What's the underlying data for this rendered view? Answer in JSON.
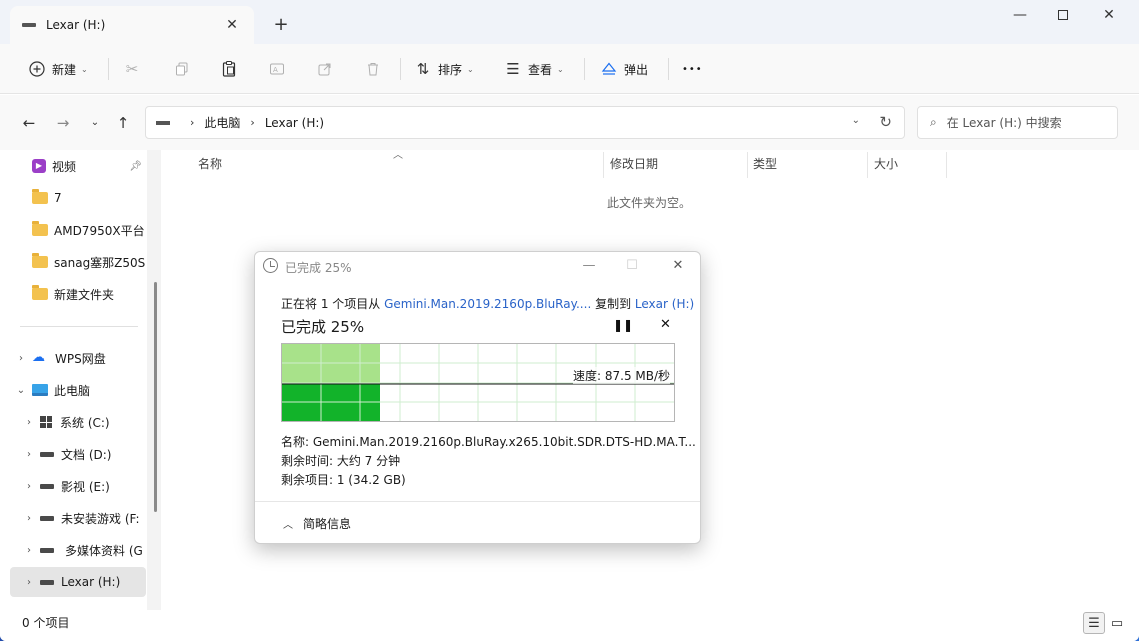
{
  "tab": {
    "title": "Lexar (H:)"
  },
  "toolbar": {
    "new_label": "新建",
    "sort_label": "排序",
    "view_label": "查看",
    "eject_label": "弹出",
    "more_label": "•••"
  },
  "address": {
    "crumbs": [
      "此电脑",
      "Lexar (H:)"
    ]
  },
  "search": {
    "placeholder": "在 Lexar (H:) 中搜索"
  },
  "sidebar": {
    "items": [
      {
        "label": "视频",
        "icon": "video-icon",
        "pinned": true
      },
      {
        "label": "7",
        "icon": "folder-icon"
      },
      {
        "label": "AMD7950X平台",
        "icon": "folder-icon"
      },
      {
        "label": "sanag塞那Z50S",
        "icon": "folder-icon"
      },
      {
        "label": "新建文件夹",
        "icon": "folder-icon"
      },
      {
        "label": "WPS网盘",
        "icon": "cloud-icon",
        "expandable": true
      },
      {
        "label": "此电脑",
        "icon": "computer-icon",
        "expanded": true
      },
      {
        "label": "系统 (C:)",
        "icon": "windows-drive-icon",
        "expandable": true
      },
      {
        "label": "文档 (D:)",
        "icon": "drive-icon",
        "expandable": true
      },
      {
        "label": "影视 (E:)",
        "icon": "drive-icon",
        "expandable": true
      },
      {
        "label": "未安装游戏 (F:",
        "icon": "drive-icon",
        "expandable": true
      },
      {
        "label": "多媒体资料 (G",
        "icon": "drive-icon",
        "expandable": true
      },
      {
        "label": "Lexar (H:)",
        "icon": "drive-icon",
        "expandable": true,
        "selected": true
      }
    ]
  },
  "columns": [
    "名称",
    "修改日期",
    "类型",
    "大小"
  ],
  "empty_message": "此文件夹为空。",
  "status": {
    "item_count": "0 个项目"
  },
  "copy_dialog": {
    "title": "已完成 25%",
    "line_prefix": "正在将 1 个项目从 ",
    "source": "Gemini.Man.2019.2160p.BluRay....",
    "line_mid": " 复制到 ",
    "dest": "Lexar (H:)",
    "percent_text": "已完成 25%",
    "progress": 0.25,
    "speed_text": "速度: 87.5 MB/秒",
    "name_line": "名称:  Gemini.Man.2019.2160p.BluRay.x265.10bit.SDR.DTS-HD.MA.T...",
    "time_line": "剩余时间: 大约 7 分钟",
    "items_line": "剩余项目: 1 (34.2 GB)",
    "less_info": "简略信息"
  },
  "colors": {
    "accent": "#2a63c8",
    "progress_fill": "#a8e28a",
    "progress_dark": "#12b32a"
  }
}
